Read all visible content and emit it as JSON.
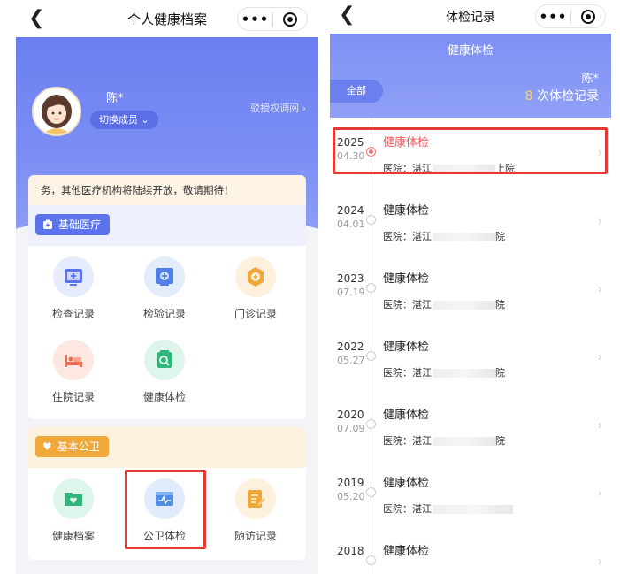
{
  "left": {
    "title": "个人健康档案",
    "capsule": {
      "more": "•••"
    },
    "user": {
      "name": "陈*",
      "switch_label": "切换成员",
      "auth_label": "驳授权调阅"
    },
    "notice": "务，其他医疗机构将陆续开放，敬请期待！",
    "section1": {
      "title": "基础医疗",
      "items": [
        {
          "label": "检查记录",
          "icon": "exam-record-icon"
        },
        {
          "label": "检验记录",
          "icon": "lab-record-icon"
        },
        {
          "label": "门诊记录",
          "icon": "outpatient-record-icon"
        },
        {
          "label": "住院记录",
          "icon": "inpatient-bed-icon"
        },
        {
          "label": "健康体检",
          "icon": "health-checkup-icon"
        }
      ]
    },
    "section2": {
      "title": "基本公卫",
      "items": [
        {
          "label": "健康档案",
          "icon": "health-file-icon"
        },
        {
          "label": "公卫体检",
          "icon": "public-health-exam-icon"
        },
        {
          "label": "随访记录",
          "icon": "followup-record-icon"
        }
      ]
    }
  },
  "right": {
    "title": "体检记录",
    "capsule": {
      "more": "•••"
    },
    "section_title": "健康体检",
    "filter_label": "全部",
    "user_name": "陈*",
    "count": "8",
    "count_suffix": " 次体检记录",
    "records": [
      {
        "year": "2025",
        "md": "04.30",
        "name": "健康体检",
        "hospital": "医院：湛江",
        "hospital_tail": "上院",
        "active": true
      },
      {
        "year": "2024",
        "md": "04.01",
        "name": "健康体检",
        "hospital": "医院：湛江",
        "hospital_tail": "院",
        "active": false
      },
      {
        "year": "2023",
        "md": "07.19",
        "name": "健康体检",
        "hospital": "医院：湛江",
        "hospital_tail": "院",
        "active": false
      },
      {
        "year": "2022",
        "md": "05.27",
        "name": "健康体检",
        "hospital": "医院：湛江",
        "hospital_tail": "院",
        "active": false
      },
      {
        "year": "2020",
        "md": "07.09",
        "name": "健康体检",
        "hospital": "医院：湛江",
        "hospital_tail": "院",
        "active": false
      },
      {
        "year": "2019",
        "md": "05.20",
        "name": "健康体检",
        "hospital": "医院：湛江",
        "hospital_tail": "",
        "active": false
      },
      {
        "year": "2018",
        "md": "",
        "name": "健康体检",
        "hospital": "",
        "hospital_tail": "",
        "active": false
      }
    ]
  },
  "colors": {
    "accent": "#6a7ef0",
    "highlight": "#e53935",
    "active_text": "#f2575a",
    "count": "#ffd35c"
  }
}
